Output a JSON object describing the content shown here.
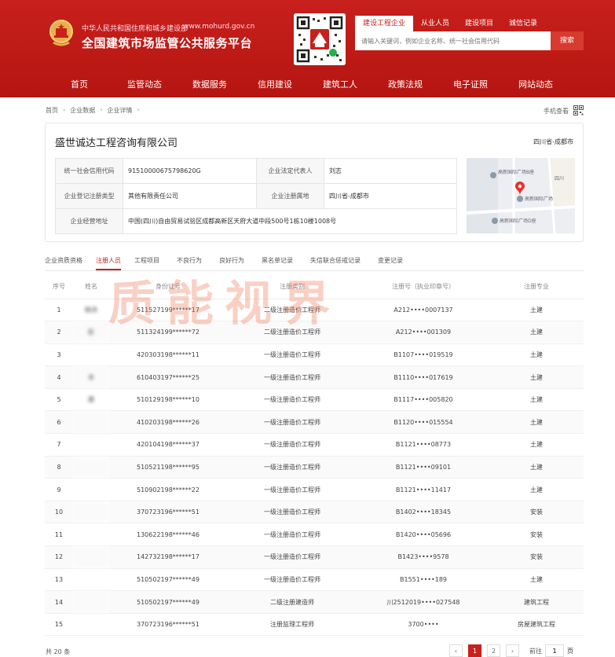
{
  "header": {
    "ministry": "中华人民共和国住房和城乡建设部",
    "url": "www.mohurd.gov.cn",
    "title": "全国建筑市场监管公共服务平台",
    "search": {
      "tabs": [
        "建设工程企业",
        "从业人员",
        "建设项目",
        "诚信记录"
      ],
      "placeholder": "请输入关键词，例如企业名称、统一社会信用代码",
      "button": "搜索"
    },
    "nav": [
      "首页",
      "监管动态",
      "数据服务",
      "信用建设",
      "建筑工人",
      "政策法规",
      "电子证照",
      "网站动态"
    ]
  },
  "breadcrumb": [
    "首页",
    "企业数据",
    "企业详情"
  ],
  "mobile_view": "手机查看",
  "company": {
    "name": "盛世诚达工程咨询有限公司",
    "region": "四川省-成都市",
    "fields": {
      "credit_code_label": "统一社会信用代码",
      "credit_code": "91510000675798620G",
      "legal_rep_label": "企业法定代表人",
      "legal_rep": "刘志",
      "reg_type_label": "企业登记注册类型",
      "reg_type": "其他有限责任公司",
      "reg_place_label": "企业注册属地",
      "reg_place": "四川省-成都市",
      "address_label": "企业经营地址",
      "address": "中国(四川)自由贸易试验区成都高新区天府大道中段500号1栋10楼1008号"
    },
    "map_labels": [
      "高新国际广场B座",
      "四川",
      "高新国际广场",
      "高新国际广场D座"
    ]
  },
  "tabs": [
    "企业资质资格",
    "注册人员",
    "工程项目",
    "不良行为",
    "良好行为",
    "黑名单记录",
    "失信联合惩戒记录",
    "变更记录"
  ],
  "table": {
    "headers": [
      "序号",
      "姓名",
      "身份证号",
      "注册类别",
      "注册号（执业印章号）",
      "注册专业"
    ],
    "rows": [
      [
        "1",
        "韩洪",
        "511527199******17",
        "二级注册造价工程师",
        "A212••••0007137",
        "土建"
      ],
      [
        "2",
        "彭",
        "511324199******72",
        "二级注册造价工程师",
        "A212••••001309",
        "土建"
      ],
      [
        "3",
        "",
        "420303198******11",
        "一级注册造价工程师",
        "B1107••••019519",
        "土建"
      ],
      [
        "4",
        "丰",
        "610403197******25",
        "一级注册造价工程师",
        "B1110••••017619",
        "土建"
      ],
      [
        "5",
        "建",
        "510129198******10",
        "一级注册造价工程师",
        "B1117••••005820",
        "土建"
      ],
      [
        "6",
        "",
        "410203198******26",
        "一级注册造价工程师",
        "B1120••••015554",
        "土建"
      ],
      [
        "7",
        "",
        "420104198******37",
        "一级注册造价工程师",
        "B1121••••08773",
        "土建"
      ],
      [
        "8",
        "",
        "510521198******95",
        "一级注册造价工程师",
        "B1121••••09101",
        "土建"
      ],
      [
        "9",
        "",
        "510902198******22",
        "一级注册造价工程师",
        "B1121••••11417",
        "土建"
      ],
      [
        "10",
        "",
        "370723196******51",
        "一级注册造价工程师",
        "B1402••••18345",
        "安装"
      ],
      [
        "11",
        "",
        "130622198******46",
        "一级注册造价工程师",
        "B1420••••05696",
        "安装"
      ],
      [
        "12",
        "",
        "142732198******17",
        "一级注册造价工程师",
        "B1423••••9578",
        "安装"
      ],
      [
        "13",
        "",
        "510502197******49",
        "一级注册造价工程师",
        "B1551••••189",
        "土建"
      ],
      [
        "14",
        "",
        "510502197******49",
        "二级注册建造师",
        "川2512019••••027548",
        "建筑工程"
      ],
      [
        "15",
        "",
        "370723196******51",
        "注册监理工程师",
        "3700••••",
        "房屋建筑工程"
      ]
    ]
  },
  "footer": {
    "total": "共 20 条",
    "pages": [
      "1",
      "2"
    ],
    "prev": "‹",
    "next": "›",
    "goto_prefix": "前往",
    "goto_value": "1",
    "goto_suffix": "页"
  },
  "watermark": "质能视界",
  "colors": {
    "brand_red": "#c8201c",
    "watermark": "#f0785a"
  }
}
